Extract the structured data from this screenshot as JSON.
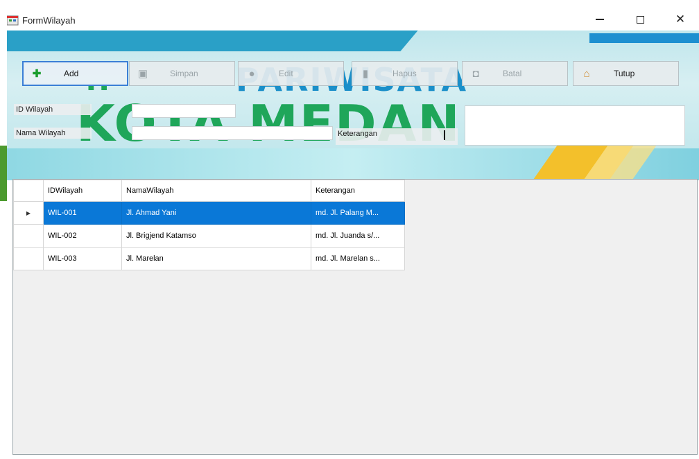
{
  "window": {
    "title": "FormWilayah",
    "controls": {
      "minimize_icon": "minimize-icon",
      "maximize_icon": "maximize-icon",
      "close_icon": "close-icon",
      "close_glyph": "✕"
    }
  },
  "banner": {
    "line1": "PARIWISATA",
    "line2": "KOTA MEDAN"
  },
  "toolbar": {
    "add": "Add",
    "edit": "Simpan",
    "save": "Edit",
    "delete": "Hapus",
    "cancel": "Batal",
    "close": "Tutup"
  },
  "form": {
    "id_label": "ID Wilayah",
    "id_value": "",
    "nama_label": "Nama Wilayah",
    "nama_value": "",
    "ket_label": "Keterangan",
    "ket_value": ""
  },
  "grid": {
    "columns": [
      "IDWilayah",
      "NamaWilayah",
      "Keterangan"
    ],
    "rows": [
      [
        "WIL-001",
        "Jl. Ahmad Yani",
        "md. Jl. Palang M..."
      ],
      [
        "WIL-002",
        "Jl. Brigjend Katamso",
        "md. Jl. Juanda s/..."
      ],
      [
        "WIL-003",
        "Jl. Marelan",
        "md. Jl. Marelan s..."
      ]
    ],
    "selected_row": 0,
    "row_indicator": "▶"
  },
  "colors": {
    "selection": "#0a78d7",
    "focus_border": "#3b7fd6"
  }
}
